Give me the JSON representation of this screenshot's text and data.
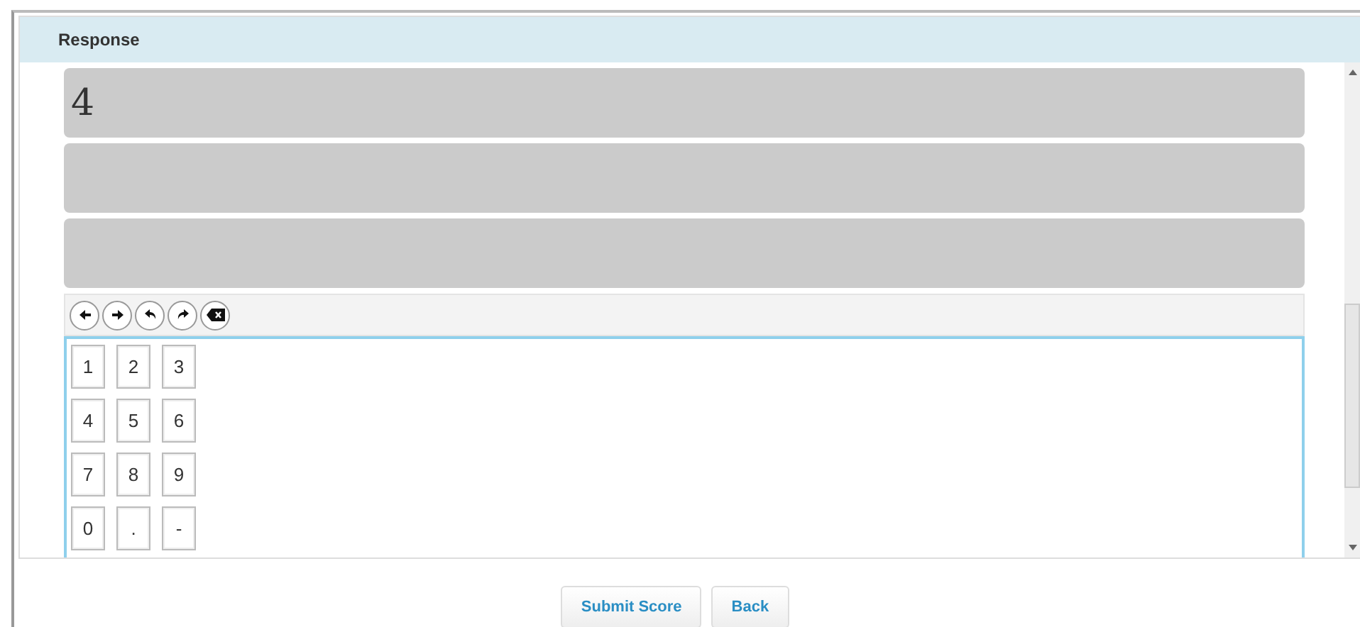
{
  "panel": {
    "title": "Response"
  },
  "answer_rows": [
    "4",
    "",
    ""
  ],
  "toolbar": [
    {
      "kind": "left"
    },
    {
      "kind": "right"
    },
    {
      "kind": "undo"
    },
    {
      "kind": "redo"
    },
    {
      "kind": "delete"
    }
  ],
  "keypad": [
    [
      "1",
      "2",
      "3"
    ],
    [
      "4",
      "5",
      "6"
    ],
    [
      "7",
      "8",
      "9"
    ],
    [
      "0",
      ".",
      "-"
    ]
  ],
  "buttons": [
    "Submit Score",
    "Back"
  ]
}
